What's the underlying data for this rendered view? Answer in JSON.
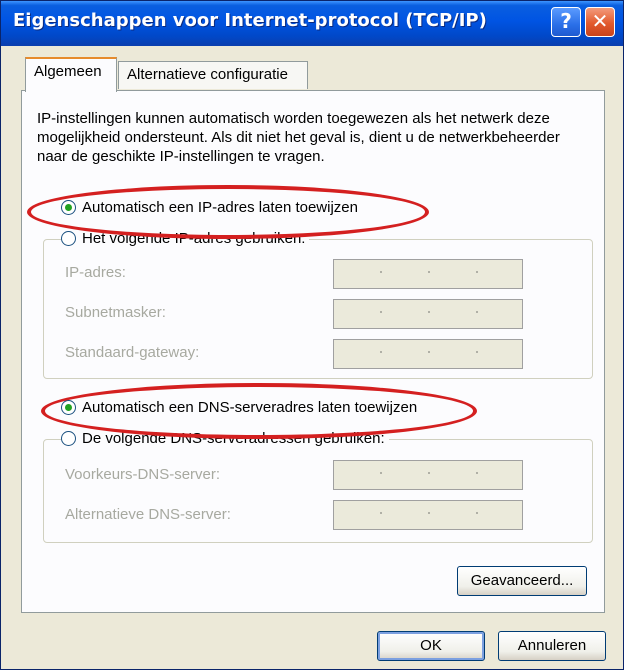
{
  "window": {
    "title": "Eigenschappen voor Internet-protocol (TCP/IP)",
    "help_symbol": "?",
    "close_symbol": "✕"
  },
  "tabs": [
    {
      "label": "Algemeen",
      "active": true
    },
    {
      "label": "Alternatieve configuratie",
      "active": false
    }
  ],
  "intro": "IP-instellingen kunnen automatisch worden toegewezen als het netwerk deze mogelijkheid ondersteunt. Als dit niet het geval is, dient u de netwerkbeheerder naar de geschikte IP-instellingen te vragen.",
  "ip": {
    "auto_label": "Automatisch een IP-adres laten toewijzen",
    "auto_selected": true,
    "manual_label": "Het volgende IP-adres gebruiken:",
    "fields": [
      {
        "label": "IP-adres:"
      },
      {
        "label": "Subnetmasker:"
      },
      {
        "label": "Standaard-gateway:"
      }
    ]
  },
  "dns": {
    "auto_label": "Automatisch een DNS-serveradres laten toewijzen",
    "auto_selected": true,
    "manual_label": "De volgende DNS-serveradressen gebruiken:",
    "fields": [
      {
        "label": "Voorkeurs-DNS-server:"
      },
      {
        "label": "Alternatieve DNS-server:"
      }
    ]
  },
  "buttons": {
    "advanced": "Geavanceerd...",
    "ok": "OK",
    "cancel": "Annuleren"
  },
  "colors": {
    "titlebar": "#0054e3",
    "highlight_ellipse": "#d42020",
    "radio_dot": "#21a121"
  }
}
